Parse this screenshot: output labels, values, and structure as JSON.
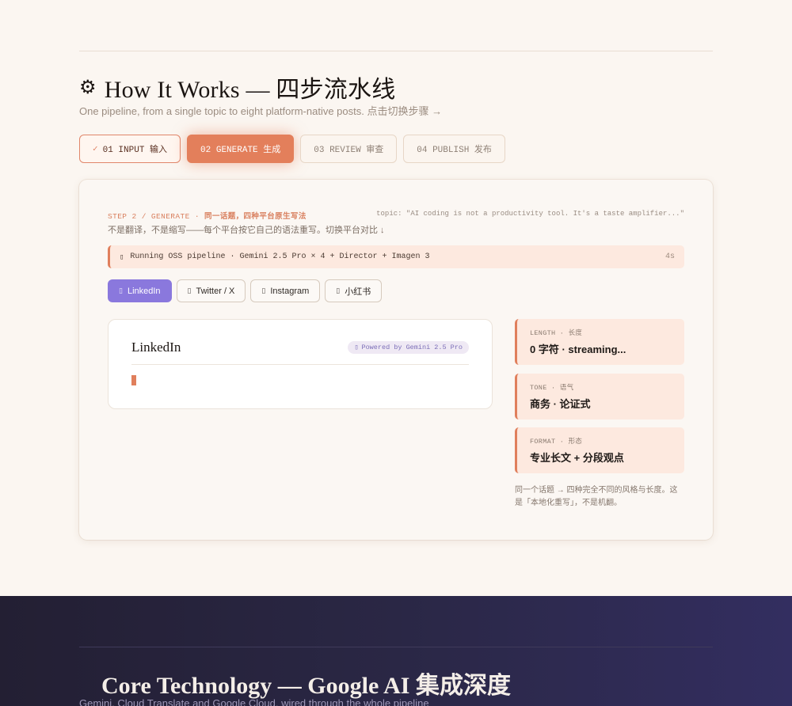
{
  "how_it_works": {
    "title_icon": "⚙",
    "title": "How It Works — 四步流水线",
    "subtitle": "One pipeline, from a single topic to eight platform-native posts. 点击切换步骤 →"
  },
  "steps": [
    {
      "check": "✓",
      "label": "01 INPUT 输入",
      "state": "done"
    },
    {
      "label": "02 GENERATE 生成",
      "state": "active"
    },
    {
      "label": "03 REVIEW 审查",
      "state": "idle"
    },
    {
      "label": "04 PUBLISH 发布",
      "state": "idle"
    }
  ],
  "card": {
    "step_label_mono": "STEP 2 / GENERATE · ",
    "step_label_cn": "同一话题，四种平台原生写法",
    "topic": "topic: \"AI coding is not a productivity tool. It's a taste amplifier...\"",
    "description": "不是翻译，不是缩写——每个平台按它自己的语法重写。切换平台对比 ↓",
    "pipeline": {
      "icon": "▯",
      "text": "Running OSS pipeline · Gemini 2.5 Pro × 4 + Director + Imagen 3",
      "time": "4s"
    },
    "platforms": [
      {
        "icon": "▯",
        "label": "LinkedIn",
        "active": true
      },
      {
        "icon": "▯",
        "label": "Twitter / X",
        "active": false
      },
      {
        "icon": "▯",
        "label": "Instagram",
        "active": false
      },
      {
        "icon": "▯",
        "label": "小红书",
        "active": false
      }
    ],
    "preview": {
      "title": "LinkedIn",
      "powered_icon": "▯",
      "powered": "Powered by Gemini 2.5 Pro"
    },
    "metrics": [
      {
        "label": "LENGTH · 长度",
        "value": "0 字符 · streaming..."
      },
      {
        "label": "TONE · 语气",
        "value": "商务 · 论证式"
      },
      {
        "label": "FORMAT · 形态",
        "value": "专业长文 + 分段观点"
      }
    ],
    "note": "同一个话题 → 四种完全不同的风格与长度。这是「本地化重写」，不是机翻。"
  },
  "core_tech": {
    "title": "Core Technology — Google AI 集成深度",
    "subtitle": "Gemini, Cloud Translate and Google Cloud, wired through the whole pipeline"
  },
  "colors": {
    "accent": "#e37f5b",
    "platform_active": "#8a78dd",
    "background": "#fbf6f1",
    "dark_section": "#2a2745"
  }
}
